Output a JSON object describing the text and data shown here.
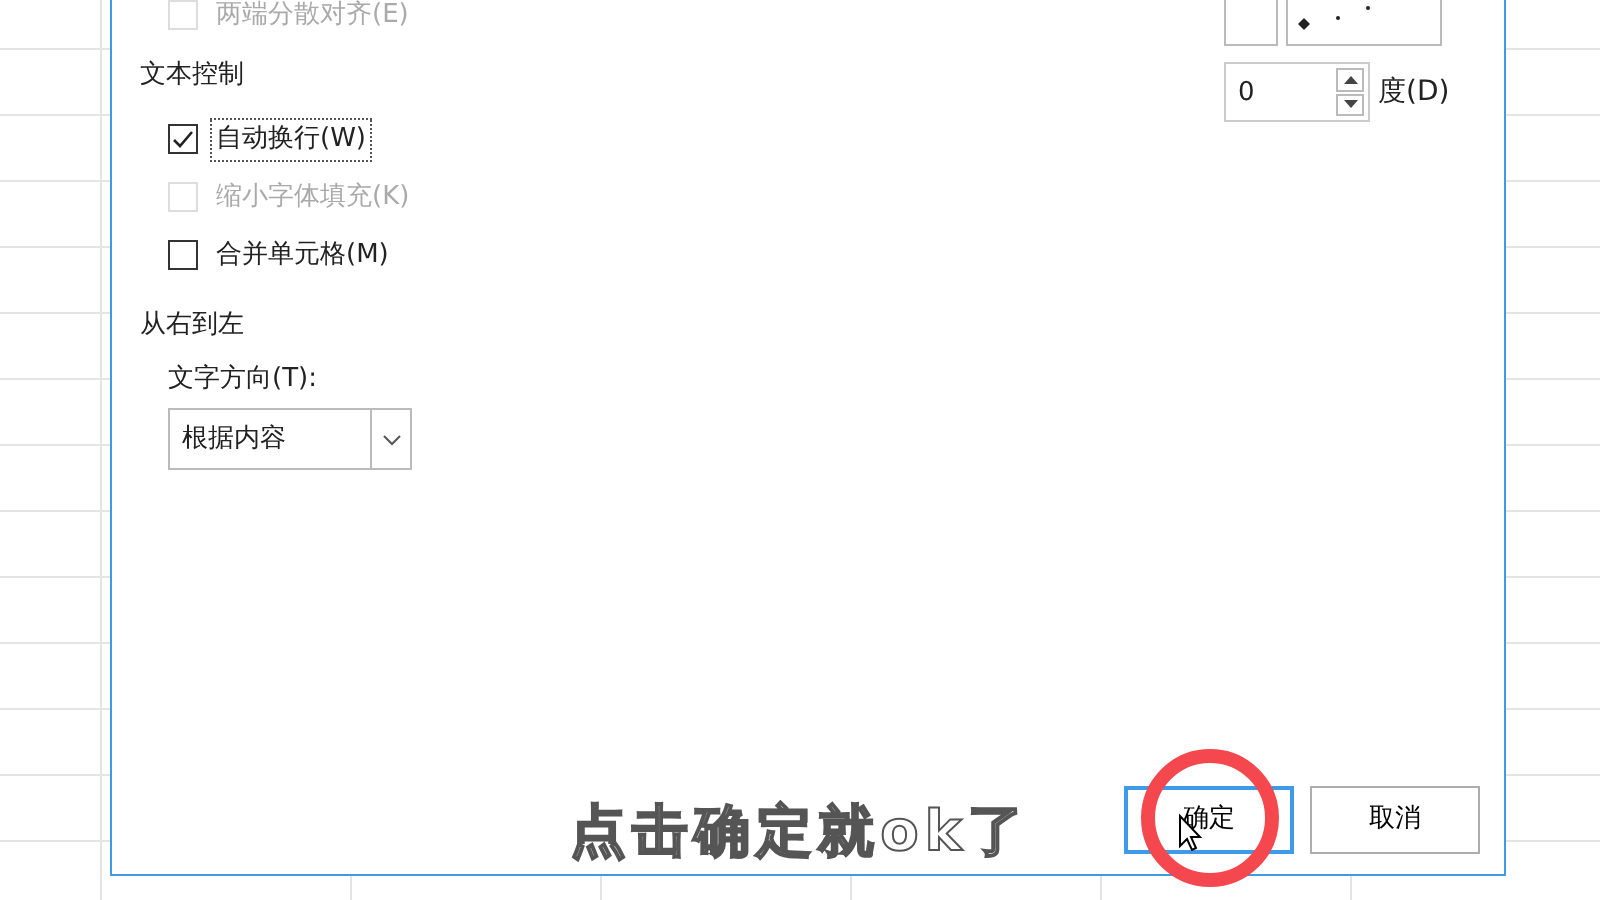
{
  "alignment_options": [
    {
      "label": "两端分散对齐(E)",
      "checked": false,
      "disabled": true,
      "focused": false
    }
  ],
  "text_control": {
    "heading": "文本控制",
    "options": [
      {
        "label": "自动换行(W)",
        "checked": true,
        "disabled": false,
        "focused": true
      },
      {
        "label": "缩小字体填充(K)",
        "checked": false,
        "disabled": true,
        "focused": false
      },
      {
        "label": "合并单元格(M)",
        "checked": false,
        "disabled": false,
        "focused": false
      }
    ]
  },
  "right_to_left": {
    "heading": "从右到左",
    "direction_label": "文字方向(T):",
    "direction_value": "根据内容"
  },
  "orientation": {
    "degrees": "0",
    "degrees_label": "度(D)"
  },
  "buttons": [
    {
      "label": "确定",
      "default": true
    },
    {
      "label": "取消",
      "default": false
    }
  ],
  "caption": "点击确定就ok了"
}
